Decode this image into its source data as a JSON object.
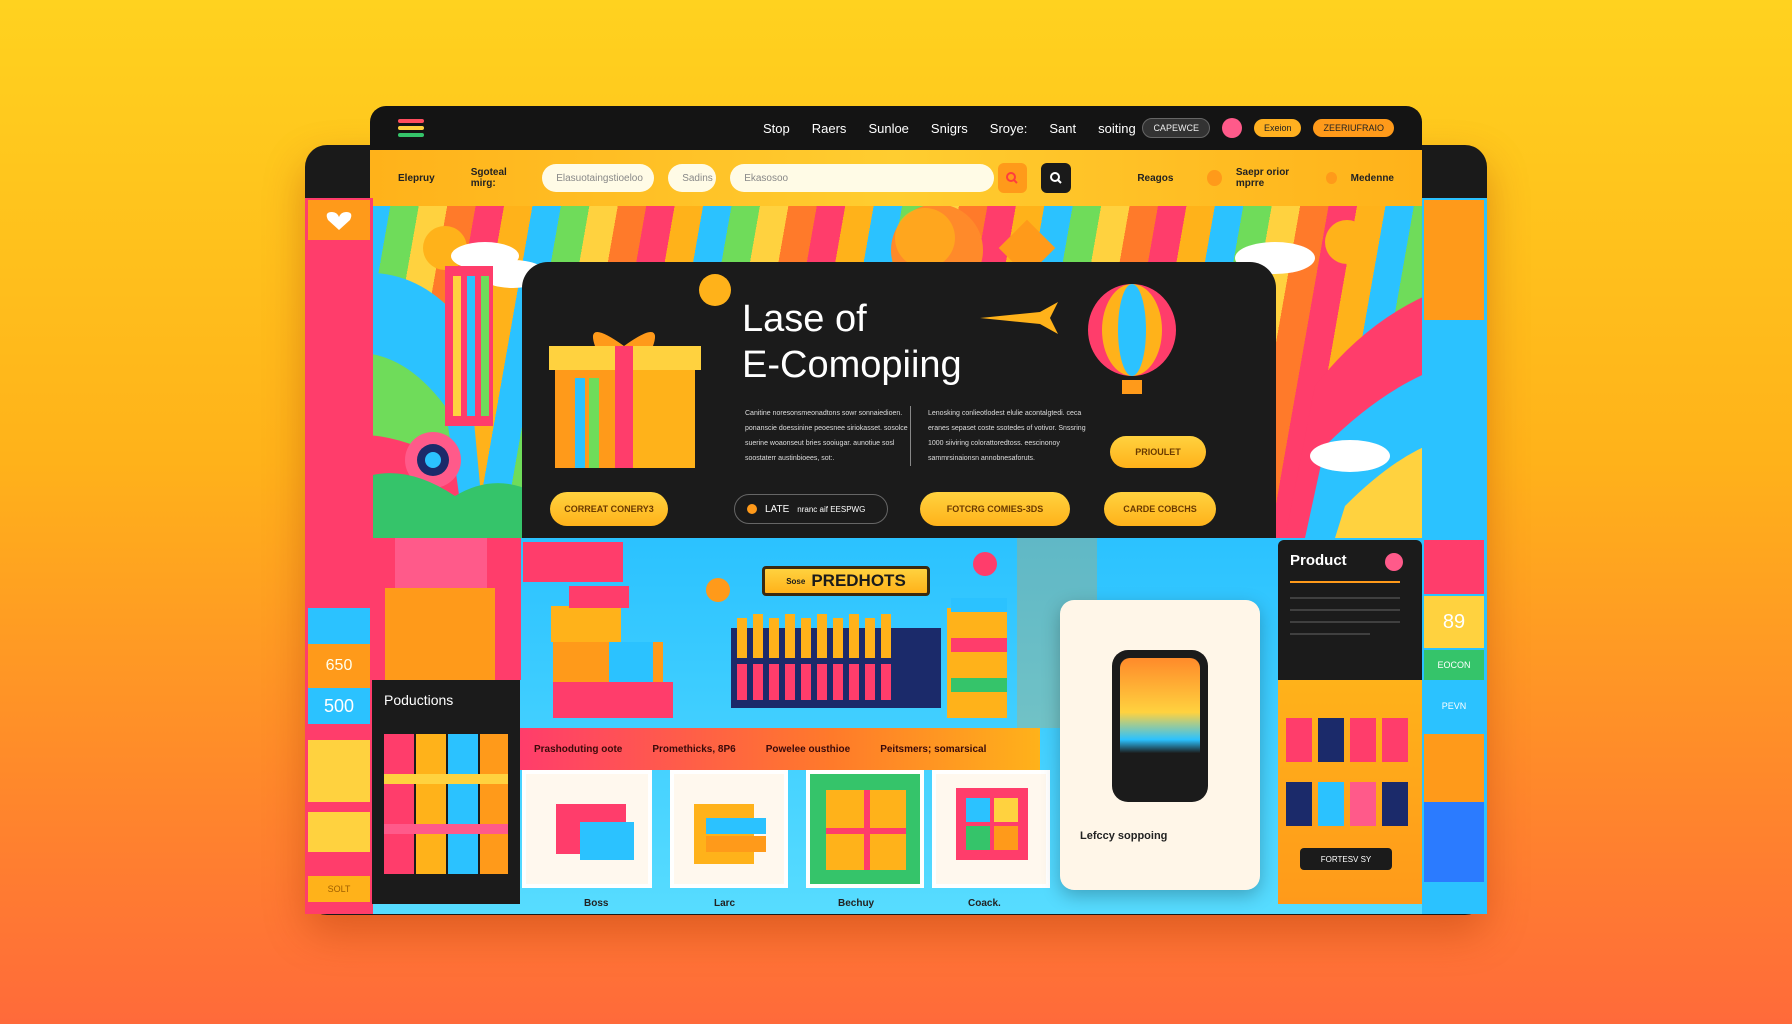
{
  "nav": {
    "links": [
      "Stop",
      "Raers",
      "Sunloe",
      "Snigrs",
      "Sroye:",
      "Sant",
      "soiting"
    ],
    "btn_dark": "CAPEWCE",
    "btn_orange": "Exeion",
    "btn_orange2": "ZEERIUFRAIO"
  },
  "search": {
    "left_label": "Elepruy",
    "left_label2": "Sgoteal mirg:",
    "field1_placeholder": "Elasuotaingstioeloo",
    "field2_placeholder": "Sadins",
    "main_placeholder": "Ekasosoo",
    "right1": "Reagos",
    "right2": "Saepr orior mprre",
    "right3": "Medenne"
  },
  "hero": {
    "title_line1": "Lase of",
    "title_line2": "E-Comopiing",
    "para_left": "Canitine noresonsmeonadtons sowr sonnaiedioen. ponanscie doessinine peoesnee siriokasset. sosolce suerine woaonseut bries sooiugar. aunotiue sosl soostaterr austinbioees, sot:.",
    "para_right": "Lenosking conlieotlodest elulie acontalgtedi. ceca eranes sepaset coste ssotedes of votivor. Snssring 1000 siiviring colorattoredtoss. eescinonoy sammrsinaionsn annobnesaforuts.",
    "cta_product": "PRIOULET",
    "btn1": "CORREAT CONERY3",
    "btn_dark_label": "LATE",
    "btn_dark_sub": "nranc aif EESPWG",
    "btn3": "FOTCRG COMIES-3DS",
    "btn4": "CARDE COBCHS"
  },
  "lower": {
    "banner_small": "Sose",
    "banner_title": "PREDHOTS",
    "features": [
      "Prashoduting oote",
      "Promethicks, 8P6",
      "Powelee ousthioe",
      "Peitsmers; somarsical"
    ],
    "card_labels": [
      "Boss",
      "Larc",
      "Bechuy",
      "Coack."
    ],
    "phone_card_title": "Lefccy soppoing",
    "productions_title": "Poductions",
    "left_tile_num1": "650",
    "left_tile_num2": "500",
    "left_small": "SOLT",
    "product_title": "Product",
    "product_btn": "FORTESV SY",
    "right_tile1": "89",
    "right_tile2": "EOCON",
    "right_tile3": "PEVN"
  }
}
